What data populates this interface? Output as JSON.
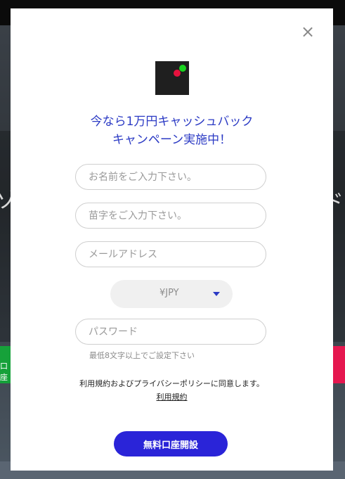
{
  "colors": {
    "accent": "#2b3ac4",
    "submit_bg": "#2a24d8",
    "logo_green": "#19d31f",
    "logo_red": "#e6123e"
  },
  "background": {
    "left_text": "ゾ",
    "right_text": "ド",
    "left_button_label": "口座"
  },
  "modal": {
    "close_icon": "×",
    "headline_line1": "今なら1万円キャッシュバック",
    "headline_line2": "キャンペーン実施中！",
    "fields": {
      "first_name_placeholder": "お名前をご入力下さい。",
      "last_name_placeholder": "苗字をご入力下さい。",
      "email_placeholder": "メールアドレス",
      "password_placeholder": "パスワード"
    },
    "currency": {
      "selected": "¥JPY"
    },
    "password_hint": "最低8文字以上でご設定下さい",
    "agree_text": "利用規約およびプライバシーポリシーに同意します。",
    "terms_link": "利用規約",
    "submit_label": "無料口座開設"
  }
}
